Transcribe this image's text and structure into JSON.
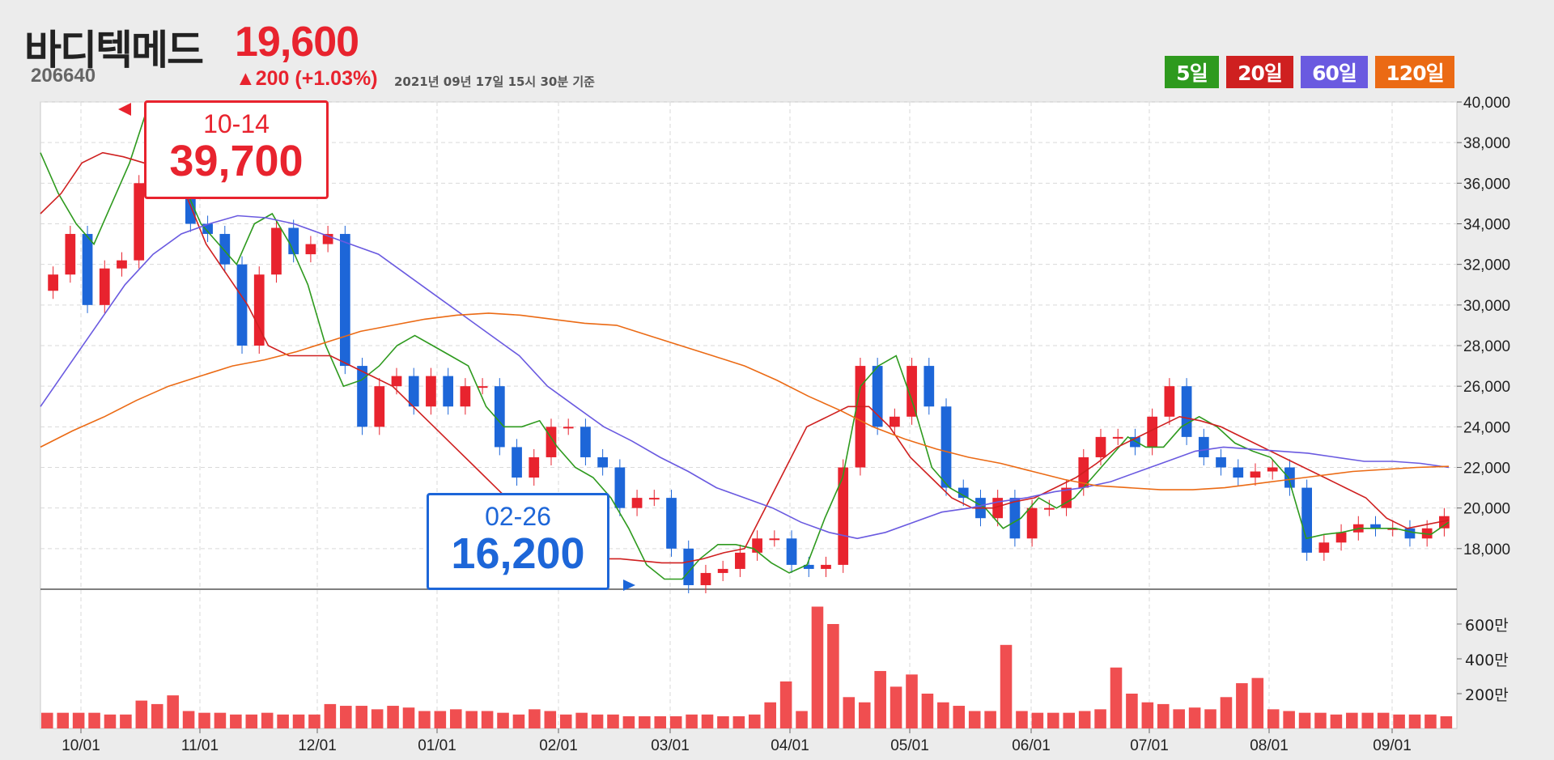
{
  "header": {
    "name": "바디텍메드",
    "price": "19,600",
    "code": "206640",
    "change": "▲200 (+1.03%)",
    "timestamp": "2021년 09년 17일 15시 30분 기준"
  },
  "ma_buttons": [
    {
      "label": "5일",
      "color": "#2e9a1e"
    },
    {
      "label": "20일",
      "color": "#cf2020"
    },
    {
      "label": "60일",
      "color": "#6a5ae0"
    },
    {
      "label": "120일",
      "color": "#eb6a14"
    }
  ],
  "callouts": {
    "high": {
      "date": "10-14",
      "value": "39,700"
    },
    "low": {
      "date": "02-26",
      "value": "16,200"
    }
  },
  "colors": {
    "up": "#e8232e",
    "down": "#1d66d8",
    "volume": "#f04e50",
    "ma5": "#2e9a1e",
    "ma20": "#cf2020",
    "ma60": "#6a5ae0",
    "ma120": "#eb6a14"
  },
  "chart_data": {
    "type": "candlestick",
    "title": "바디텍메드",
    "price_axis": {
      "ylim": [
        16000,
        40000
      ],
      "ticks": [
        "40,000",
        "38,000",
        "36,000",
        "34,000",
        "32,000",
        "30,000",
        "28,000",
        "26,000",
        "24,000",
        "22,000",
        "20,000",
        "18,000"
      ]
    },
    "volume_axis": {
      "ylim": [
        0,
        8000000
      ],
      "ticks": [
        "600만",
        "400만",
        "200만"
      ]
    },
    "x_tick_labels": [
      "10/01",
      "11/01",
      "12/01",
      "01/01",
      "02/01",
      "03/01",
      "04/01",
      "05/01",
      "06/01",
      "07/01",
      "08/01",
      "09/01"
    ],
    "grid": true,
    "close_series": [
      31500,
      33500,
      30000,
      31800,
      32200,
      36000,
      37000,
      39000,
      34000,
      33500,
      32000,
      28000,
      31500,
      33800,
      32500,
      33000,
      33500,
      27000,
      24000,
      26000,
      26500,
      25000,
      26500,
      25000,
      26000,
      26000,
      23000,
      21500,
      22500,
      24000,
      24000,
      22500,
      22000,
      20000,
      20500,
      20500,
      18000,
      16200,
      16800,
      17000,
      17800,
      18500,
      18500,
      17200,
      17000,
      17200,
      22000,
      27000,
      24000,
      24500,
      27000,
      25000,
      21000,
      20500,
      19500,
      20500,
      18500,
      20000,
      20000,
      21000,
      22500,
      23500,
      23500,
      23000,
      24500,
      26000,
      23500,
      22500,
      22000,
      21500,
      21800,
      22000,
      21000,
      17800,
      18300,
      18800,
      19200,
      19000,
      19000,
      18500,
      19000,
      19600
    ],
    "ma_series": {
      "5일": [
        37500,
        35500,
        34000,
        33000,
        35000,
        37000,
        39700,
        38000,
        36000,
        34000,
        33000,
        32000,
        34000,
        34500,
        33000,
        31000,
        28000,
        26000,
        26300,
        27000,
        28000,
        28500,
        28000,
        27500,
        27000,
        25000,
        24000,
        24000,
        24300,
        23000,
        22000,
        21500,
        20500,
        19000,
        17200,
        16500,
        16500,
        17500,
        18200,
        18200,
        18000,
        17300,
        16800,
        17200,
        19500,
        21500,
        26000,
        27000,
        27500,
        25000,
        22000,
        21000,
        20500,
        20000,
        19000,
        19500,
        20500,
        20000,
        20500,
        21500,
        22500,
        23500,
        23000,
        23000,
        24000,
        24500,
        24000,
        23200,
        22800,
        22500,
        21500,
        18500,
        18700,
        18800,
        19000,
        19000,
        19000,
        18800,
        18700,
        19300
      ],
      "20일": [
        34500,
        35500,
        37000,
        37500,
        37300,
        37000,
        36500,
        35500,
        33000,
        31500,
        30000,
        28000,
        27500,
        27500,
        27500,
        27000,
        26500,
        26000,
        25000,
        24000,
        23000,
        22000,
        21000,
        20000,
        19000,
        18500,
        18000,
        17500,
        17500,
        17400,
        17300,
        17300,
        17500,
        17800,
        18000,
        20000,
        22000,
        24000,
        24500,
        25000,
        25000,
        24000,
        22500,
        21500,
        20500,
        20000,
        20000,
        20300,
        20500,
        21000,
        21500,
        22200,
        23000,
        23500,
        24000,
        24500,
        24300,
        24000,
        23500,
        23000,
        22500,
        22000,
        21500,
        21000,
        20500,
        19500,
        19000,
        19200,
        19400
      ],
      "60일": [
        25000,
        27000,
        29000,
        31000,
        32500,
        33500,
        34000,
        34400,
        34300,
        34000,
        33500,
        33000,
        32500,
        31500,
        30500,
        29500,
        28500,
        27500,
        26000,
        25000,
        24000,
        23300,
        22500,
        21800,
        21000,
        20500,
        20000,
        19300,
        18800,
        18500,
        18800,
        19300,
        19800,
        20000,
        20300,
        20500,
        20800,
        21000,
        21300,
        21800,
        22300,
        22800,
        23000,
        22900,
        22800,
        22700,
        22500,
        22300,
        22300,
        22200,
        22000
      ],
      "120일": [
        23000,
        23800,
        24500,
        25300,
        26000,
        26500,
        27000,
        27300,
        27700,
        28200,
        28700,
        29000,
        29300,
        29500,
        29600,
        29500,
        29300,
        29100,
        29000,
        28500,
        28000,
        27500,
        27000,
        26300,
        25500,
        24800,
        24000,
        23400,
        22900,
        22500,
        22200,
        21800,
        21400,
        21100,
        21000,
        20900,
        20900,
        21000,
        21200,
        21400,
        21600,
        21800,
        21900,
        22000,
        22050
      ]
    },
    "volume_series": [
      900000,
      900000,
      900000,
      900000,
      800000,
      800000,
      1600000,
      1400000,
      1900000,
      1000000,
      900000,
      900000,
      800000,
      800000,
      900000,
      800000,
      800000,
      800000,
      1400000,
      1300000,
      1300000,
      1100000,
      1300000,
      1200000,
      1000000,
      1000000,
      1100000,
      1000000,
      1000000,
      900000,
      800000,
      1100000,
      1000000,
      800000,
      900000,
      800000,
      800000,
      700000,
      700000,
      700000,
      700000,
      800000,
      800000,
      700000,
      700000,
      800000,
      1500000,
      2700000,
      1000000,
      7000000,
      6000000,
      1800000,
      1500000,
      3300000,
      2400000,
      3100000,
      2000000,
      1500000,
      1300000,
      1000000,
      1000000,
      4800000,
      1000000,
      900000,
      900000,
      900000,
      1000000,
      1100000,
      3500000,
      2000000,
      1500000,
      1400000,
      1100000,
      1200000,
      1100000,
      1800000,
      2600000,
      2900000,
      1100000,
      1000000,
      900000,
      900000,
      800000,
      900000,
      900000,
      900000,
      800000,
      800000,
      800000,
      700000
    ]
  }
}
